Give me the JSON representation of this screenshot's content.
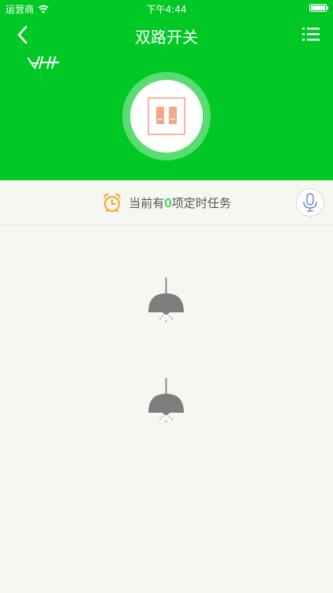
{
  "statusbar": {
    "carrier": "运营商",
    "time": "下午4:44",
    "battery_level": 1.0
  },
  "navbar": {
    "title": "双路开关",
    "back_icon": "chevron-left-icon",
    "menu_icon": "list-menu-icon"
  },
  "device": {
    "icon": "double-switch-icon",
    "brand_logo": "vh-brand-logo"
  },
  "timer": {
    "prefix": "当前有",
    "count": "0",
    "suffix": "项定时任务",
    "icon": "alarm-clock-icon",
    "mic_icon": "microphone-icon"
  },
  "lamps": [
    {
      "icon": "pendant-lamp-icon",
      "state": "off"
    },
    {
      "icon": "pendant-lamp-icon",
      "state": "off"
    }
  ],
  "colors": {
    "primary_green": "#00c925",
    "switch_orange": "#f4a58a",
    "alarm_orange": "#f5a623",
    "lamp_gray": "#7d7d7d",
    "background": "#f7f7f2"
  }
}
